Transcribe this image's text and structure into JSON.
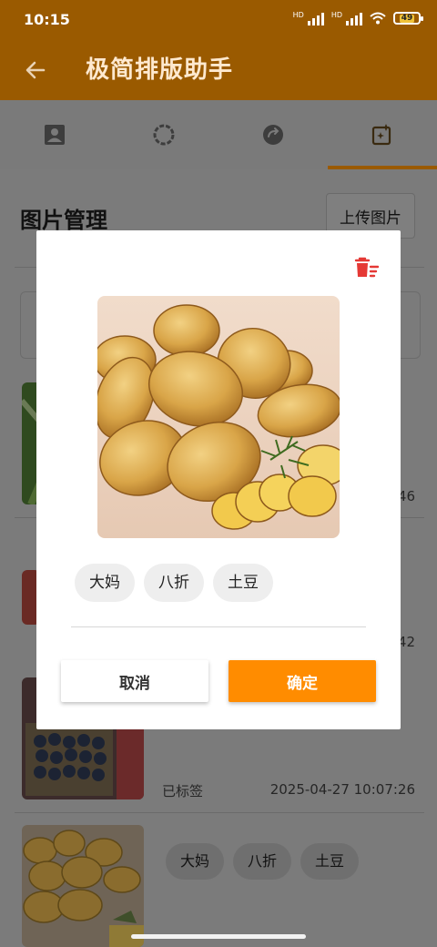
{
  "status_bar": {
    "time": "10:15",
    "battery": "49",
    "signal_labels": [
      "HD",
      "HD"
    ]
  },
  "app_bar": {
    "title": "极简排版助手",
    "back_icon": "arrow-left-icon"
  },
  "tabs": [
    {
      "icon": "contact-card-icon",
      "active": false
    },
    {
      "icon": "loading-circle-icon",
      "active": false
    },
    {
      "icon": "redo-circle-icon",
      "active": false
    },
    {
      "icon": "image-edit-icon",
      "active": true
    }
  ],
  "page": {
    "section_title": "图片管理",
    "upload_label": "上传图片",
    "items": [
      {
        "time_fragment": "46"
      },
      {
        "time_fragment": "42"
      },
      {
        "status": "已标签",
        "time": "2025-04-27 10:07:26"
      },
      {
        "tags": [
          "大妈",
          "八折",
          "土豆"
        ]
      }
    ]
  },
  "dialog": {
    "tags": [
      "大妈",
      "八折",
      "土豆"
    ],
    "cancel_label": "取消",
    "confirm_label": "确定",
    "delete_icon": "delete-sweep-icon"
  },
  "colors": {
    "accent": "#ff8c00",
    "app_bar": "#9a5a00",
    "danger": "#e53935"
  }
}
